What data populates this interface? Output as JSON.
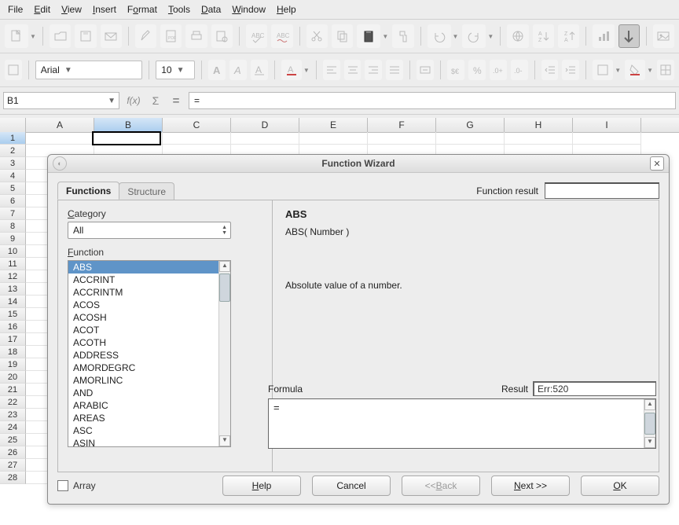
{
  "menu": {
    "file": {
      "pre": "F",
      "u": "",
      "post": "ile"
    },
    "edit": {
      "pre": "",
      "u": "E",
      "post": "dit"
    },
    "view": {
      "pre": "",
      "u": "V",
      "post": "iew"
    },
    "insert": {
      "pre": "",
      "u": "I",
      "post": "nsert"
    },
    "format": {
      "pre": "F",
      "u": "o",
      "post": "rmat"
    },
    "tools": {
      "pre": "",
      "u": "T",
      "post": "ools"
    },
    "data": {
      "pre": "",
      "u": "D",
      "post": "ata"
    },
    "window": {
      "pre": "",
      "u": "W",
      "post": "indow"
    },
    "help": {
      "pre": "",
      "u": "H",
      "post": "elp"
    }
  },
  "font": {
    "name": "Arial",
    "size": "10"
  },
  "cell_ref": "B1",
  "formula_input": "=",
  "columns": [
    "A",
    "B",
    "C",
    "D",
    "E",
    "F",
    "G",
    "H",
    "I"
  ],
  "row_count": 28,
  "selected_col": "B",
  "selected_row": 1,
  "dialog": {
    "title": "Function Wizard",
    "tab_functions": "Functions",
    "tab_structure": "Structure",
    "function_result_label": "Function result",
    "category_label": {
      "pre": "",
      "u": "C",
      "post": "ategory"
    },
    "category_value": "All",
    "function_label": {
      "pre": "",
      "u": "F",
      "post": "unction"
    },
    "functions": [
      "ABS",
      "ACCRINT",
      "ACCRINTM",
      "ACOS",
      "ACOSH",
      "ACOT",
      "ACOTH",
      "ADDRESS",
      "AMORDEGRC",
      "AMORLINC",
      "AND",
      "ARABIC",
      "AREAS",
      "ASC",
      "ASIN"
    ],
    "selected_function_idx": 0,
    "detail": {
      "name": "ABS",
      "signature": "ABS( Number )",
      "description": "Absolute value of a number."
    },
    "formula_label": "Formula",
    "result_label": "Result",
    "result_value": "Err:520",
    "formula_value": "=",
    "array_label": {
      "pre": "Arra",
      "u": "y",
      "post": ""
    },
    "btn_help": {
      "pre": "",
      "u": "H",
      "post": "elp"
    },
    "btn_cancel": "Cancel",
    "btn_back": {
      "pre": "<< ",
      "u": "B",
      "post": "ack"
    },
    "btn_next": {
      "pre": "",
      "u": "N",
      "post": "ext >>"
    },
    "btn_ok": {
      "pre": "",
      "u": "O",
      "post": "K"
    }
  }
}
